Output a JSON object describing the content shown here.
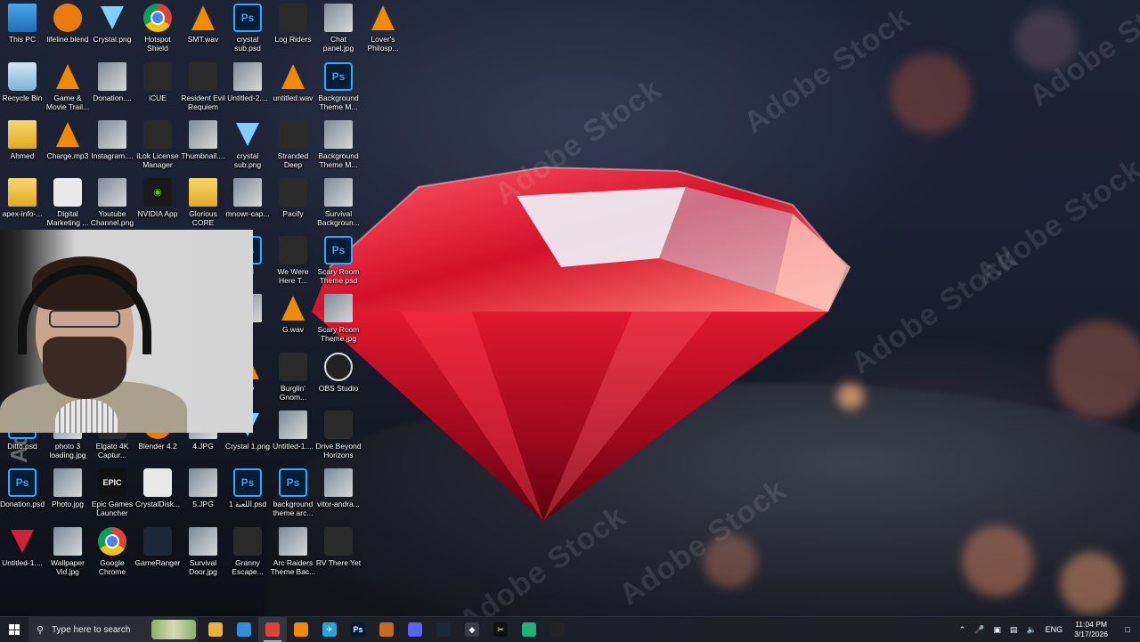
{
  "wallpaper": {
    "watermark_text": "Adobe Stock",
    "subject": "red-diamond-on-sand"
  },
  "desktop_icons": [
    {
      "label": "This PC",
      "icon": "pc-icon"
    },
    {
      "label": "lifeline.blend",
      "icon": "blender-icon"
    },
    {
      "label": "Crystal.png",
      "icon": "gem-outline-icon"
    },
    {
      "label": "Hotspot Shield",
      "icon": "hotspot-shield-icon"
    },
    {
      "label": "SMT.wav",
      "icon": "vlc-icon"
    },
    {
      "label": "crystal sub.psd",
      "icon": "photoshop-icon"
    },
    {
      "label": "Log Riders",
      "icon": "game-icon"
    },
    {
      "label": "Chat panel.jpg",
      "icon": "image-icon"
    },
    {
      "label": "Lover's Philosp...",
      "icon": "vlc-icon"
    },
    {
      "label": "Recycle Bin",
      "icon": "recycle-bin-icon"
    },
    {
      "label": "Game & Movie Trail...",
      "icon": "vlc-icon"
    },
    {
      "label": "Donation....",
      "icon": "image-icon"
    },
    {
      "label": "iCUE",
      "icon": "icue-icon"
    },
    {
      "label": "Resident Evil Requiem",
      "icon": "game-icon"
    },
    {
      "label": "Untitled-2....",
      "icon": "image-icon"
    },
    {
      "label": "untitled.wav",
      "icon": "vlc-icon"
    },
    {
      "label": "Background Theme M...",
      "icon": "photoshop-icon"
    },
    {
      "label": "Ahmed",
      "icon": "user-folder-icon"
    },
    {
      "label": "Charge.mp3",
      "icon": "vlc-icon"
    },
    {
      "label": "Instagram....",
      "icon": "image-icon"
    },
    {
      "label": "iLok License Manager",
      "icon": "ilok-icon"
    },
    {
      "label": "Thumbnail....",
      "icon": "image-icon"
    },
    {
      "label": "crystal sub.png",
      "icon": "gem-icon"
    },
    {
      "label": "Stranded Deep",
      "icon": "game-icon"
    },
    {
      "label": "Background Theme M...",
      "icon": "image-icon"
    },
    {
      "label": "apex-info-...",
      "icon": "file-icon"
    },
    {
      "label": "Digital Marketing ...",
      "icon": "document-icon"
    },
    {
      "label": "Youtube Channel.png",
      "icon": "image-icon"
    },
    {
      "label": "NVIDIA App",
      "icon": "nvidia-icon"
    },
    {
      "label": "Glorious CORE",
      "icon": "glorious-icon"
    },
    {
      "label": "mnowr-cap...",
      "icon": "image-icon"
    },
    {
      "label": "Pacify",
      "icon": "game-icon"
    },
    {
      "label": "Survival Backgroun...",
      "icon": "image-icon"
    },
    {
      "label": "psd",
      "icon": "photoshop-icon"
    },
    {
      "label": "We Were Here T...",
      "icon": "game-icon"
    },
    {
      "label": "Scary Room Theme.psd",
      "icon": "photoshop-icon"
    },
    {
      "label": ".gif",
      "icon": "image-icon"
    },
    {
      "label": "G.wav",
      "icon": "vlc-icon"
    },
    {
      "label": "Scary Room Theme.jpg",
      "icon": "image-icon"
    },
    {
      "label": "wav",
      "icon": "vlc-icon"
    },
    {
      "label": "Burglin' Gnom...",
      "icon": "game-icon"
    },
    {
      "label": "OBS Studio",
      "icon": "obs-icon"
    },
    {
      "label": "Ditto.psd",
      "icon": "photoshop-icon"
    },
    {
      "label": "photo 3 loading.jpg",
      "icon": "image-icon"
    },
    {
      "label": "Elgato 4K Captur...",
      "icon": "elgato-icon"
    },
    {
      "label": "Blender 4.2",
      "icon": "blender-icon"
    },
    {
      "label": "4.JPG",
      "icon": "image-icon"
    },
    {
      "label": "Crystal 1.png",
      "icon": "gem-icon"
    },
    {
      "label": "Untitled-1....",
      "icon": "image-icon"
    },
    {
      "label": "Drive Beyond Horizons",
      "icon": "game-icon"
    },
    {
      "label": "Donation.psd",
      "icon": "photoshop-icon"
    },
    {
      "label": "Photo.jpg",
      "icon": "image-icon"
    },
    {
      "label": "Epic Games Launcher",
      "icon": "epic-icon"
    },
    {
      "label": "CrystalDisk...",
      "icon": "crystaldisk-icon"
    },
    {
      "label": "5.JPG",
      "icon": "image-icon"
    },
    {
      "label": "اللعبة 1.psd",
      "icon": "photoshop-icon"
    },
    {
      "label": "background theme arc...",
      "icon": "photoshop-icon"
    },
    {
      "label": "vitor-andra...",
      "icon": "image-icon"
    },
    {
      "label": "Untitled-1....",
      "icon": "red-gem-icon"
    },
    {
      "label": "Wallpaper Vid.jpg",
      "icon": "image-icon"
    },
    {
      "label": "Google Chrome",
      "icon": "chrome-icon"
    },
    {
      "label": "GameRanger",
      "icon": "gameranger-icon"
    },
    {
      "label": "Survival Door.jpg",
      "icon": "image-icon"
    },
    {
      "label": "Granny Escape...",
      "icon": "game-icon"
    },
    {
      "label": "Arc Raiders Theme Bac...",
      "icon": "image-icon"
    },
    {
      "label": "RV There Yet",
      "icon": "game-icon"
    }
  ],
  "taskbar": {
    "search_placeholder": "Type here to search",
    "apps": [
      {
        "name": "file-explorer-icon",
        "color": "#e8b53a",
        "glyph": ""
      },
      {
        "name": "edge-icon",
        "color": "#2f8fd8",
        "glyph": ""
      },
      {
        "name": "chrome-icon",
        "color": "#db4437",
        "glyph": "",
        "active": true
      },
      {
        "name": "vlc-icon",
        "color": "#f28a00",
        "glyph": ""
      },
      {
        "name": "telegram-icon",
        "color": "#2aa3de",
        "glyph": "✈"
      },
      {
        "name": "photoshop-icon",
        "color": "#001e36",
        "glyph": "Ps"
      },
      {
        "name": "shield-icon",
        "color": "#c46b24",
        "glyph": ""
      },
      {
        "name": "discord-icon",
        "color": "#5865f2",
        "glyph": ""
      },
      {
        "name": "steam-icon",
        "color": "#1b2838",
        "glyph": ""
      },
      {
        "name": "app-icon",
        "color": "#3a3d46",
        "glyph": "◆"
      },
      {
        "name": "capcut-icon",
        "color": "#111111",
        "glyph": "✂"
      },
      {
        "name": "app-green-icon",
        "color": "#21b27a",
        "glyph": ""
      },
      {
        "name": "obs-icon",
        "color": "#222222",
        "glyph": ""
      }
    ],
    "tray": {
      "language": "ENG",
      "time": "11:04 PM",
      "date": "3/17/2026"
    }
  }
}
